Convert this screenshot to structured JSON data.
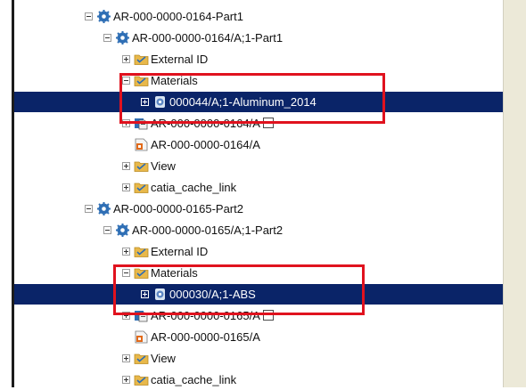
{
  "tree": {
    "rows": [
      {
        "label": "AR-000-0000-0164-Part1",
        "icon": "part-gear-icon",
        "twisty": "minus"
      },
      {
        "label": "AR-000-0000-0164/A;1-Part1",
        "icon": "part-gear-icon",
        "twisty": "minus"
      },
      {
        "label": "External ID",
        "icon": "folder-icon",
        "twisty": "plus"
      },
      {
        "label": "Materials",
        "icon": "folder-icon",
        "twisty": "minus"
      },
      {
        "label": "000044/A;1-Aluminum_2014",
        "icon": "material-icon",
        "twisty": "plus",
        "selected": true
      },
      {
        "label": "AR-000-0000-0164/A",
        "icon": "revision-icon",
        "twisty": "plus"
      },
      {
        "label": "AR-000-0000-0164/A",
        "icon": "dataset-icon",
        "twisty": "none"
      },
      {
        "label": "View",
        "icon": "folder-icon",
        "twisty": "plus"
      },
      {
        "label": "catia_cache_link",
        "icon": "folder-icon",
        "twisty": "plus"
      },
      {
        "label": "AR-000-0000-0165-Part2",
        "icon": "part-gear-icon",
        "twisty": "minus"
      },
      {
        "label": "AR-000-0000-0165/A;1-Part2",
        "icon": "part-gear-icon",
        "twisty": "minus"
      },
      {
        "label": "External ID",
        "icon": "folder-icon",
        "twisty": "plus"
      },
      {
        "label": "Materials",
        "icon": "folder-icon",
        "twisty": "minus"
      },
      {
        "label": "000030/A;1-ABS",
        "icon": "material-icon",
        "twisty": "plus",
        "selected": true
      },
      {
        "label": "AR-000-0000-0165/A",
        "icon": "revision-icon",
        "twisty": "plus"
      },
      {
        "label": "AR-000-0000-0165/A",
        "icon": "dataset-icon",
        "twisty": "none"
      },
      {
        "label": "View",
        "icon": "folder-icon",
        "twisty": "plus"
      },
      {
        "label": "catia_cache_link",
        "icon": "folder-icon",
        "twisty": "plus"
      }
    ]
  },
  "colors": {
    "selection": "#0a2468",
    "highlight_box": "#e0121e",
    "folder": "#e8b84a",
    "part_icon": "#2f6fb5"
  }
}
